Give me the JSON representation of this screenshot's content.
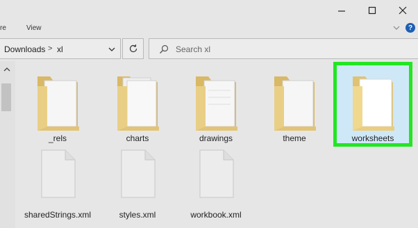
{
  "ribbon": {
    "tabs": [
      "re",
      "View"
    ]
  },
  "window": {
    "help_glyph": "?"
  },
  "address": {
    "crumbs": [
      "Downloads",
      "xl"
    ],
    "separator": ">"
  },
  "search": {
    "placeholder": "Search xl"
  },
  "items": {
    "folders": [
      {
        "name": "_rels"
      },
      {
        "name": "charts"
      },
      {
        "name": "drawings"
      },
      {
        "name": "theme"
      },
      {
        "name": "worksheets",
        "selected": true
      }
    ],
    "files": [
      {
        "name": "sharedStrings.xml"
      },
      {
        "name": "styles.xml"
      },
      {
        "name": "workbook.xml"
      }
    ]
  },
  "colors": {
    "highlight": "#22e622",
    "selection_fill": "#cfe8f8",
    "folder": "#e6c878"
  },
  "icons": [
    "minimize-icon",
    "maximize-icon",
    "close-icon",
    "chevron-down-icon",
    "help-icon",
    "refresh-icon",
    "search-icon",
    "chevron-up-icon",
    "folder-icon",
    "file-icon"
  ]
}
